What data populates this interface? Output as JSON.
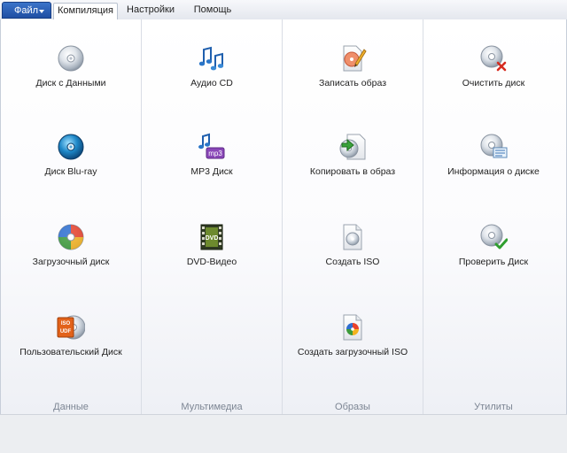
{
  "menu": {
    "file_label": "Файл",
    "tabs": [
      "Компиляция",
      "Настройки",
      "Помощь"
    ]
  },
  "groups": [
    {
      "label": "Данные",
      "items": [
        "Диск с Данными",
        "Диск Blu-ray",
        "Загрузочный диск",
        "Пользовательский Диск"
      ]
    },
    {
      "label": "Мультимедиа",
      "items": [
        "Аудио CD",
        "MP3 Диск",
        "DVD-Видео"
      ]
    },
    {
      "label": "Образы",
      "items": [
        "Записать образ",
        "Копировать в образ",
        "Создать ISO",
        "Создать загрузочный ISO"
      ]
    },
    {
      "label": "Утилиты",
      "items": [
        "Очистить диск",
        "Информация о диске",
        "Проверить Диск"
      ]
    }
  ],
  "icon_text": {
    "mp3": "mp3",
    "dvd": "DVD",
    "iso": "ISO",
    "udf": "UDF"
  }
}
